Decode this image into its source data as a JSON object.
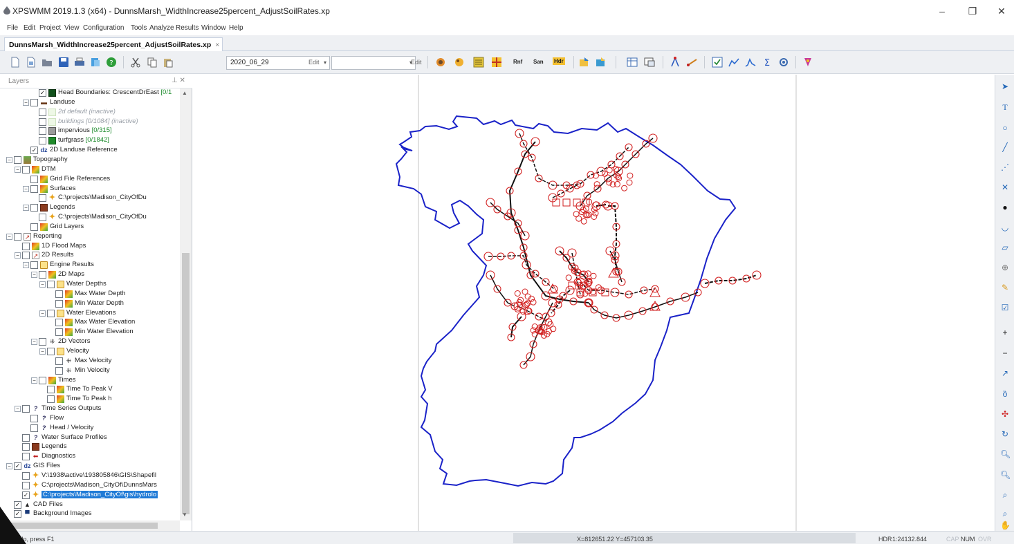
{
  "window": {
    "title": "XPSWMM 2019.1.3 (x64) - DunnsMarsh_WidthIncrease25percent_AdjustSoilRates.xp",
    "minimize": "–",
    "maximize": "❐",
    "close": "✕"
  },
  "menu": [
    "File",
    "Edit",
    "Project",
    "View",
    "Configuration",
    "Tools",
    "Analyze",
    "Results",
    "Window",
    "Help"
  ],
  "document_tab": {
    "label": "DunnsMarsh_WidthIncrease25percent_AdjustSoilRates.xp",
    "close": "×"
  },
  "toolbar": {
    "date_combo": "2020_06_29",
    "edit_label_1": "Edit",
    "second_combo": "",
    "edit_label_2": "Edit",
    "text_buttons": [
      "Rnf",
      "San",
      "Hdr"
    ]
  },
  "layers_panel": {
    "title": "Layers",
    "pin": "⊥ ✕",
    "tree": [
      {
        "level": 3,
        "expander": "",
        "checked": true,
        "icon": "dark-green-square",
        "label": "Head Boundaries: CrescentDrEast ",
        "count": "[0/1",
        "style": ""
      },
      {
        "level": 2,
        "expander": "−",
        "checked": false,
        "icon": "landuse-icon",
        "label": "Landuse",
        "count": "",
        "style": ""
      },
      {
        "level": 3,
        "expander": "",
        "checked": false,
        "icon": "faint-swatch",
        "label": "2d default (inactive)",
        "count": "",
        "style": "dim"
      },
      {
        "level": 3,
        "expander": "",
        "checked": false,
        "icon": "faint-swatch",
        "label": "buildings [0/1084] (inactive)",
        "count": "",
        "style": "dim"
      },
      {
        "level": 3,
        "expander": "",
        "checked": false,
        "icon": "gray-swatch",
        "label": "impervious ",
        "count": "[0/315]",
        "style": ""
      },
      {
        "level": 3,
        "expander": "",
        "checked": false,
        "icon": "green-swatch",
        "label": "turfgrass ",
        "count": "[0/1842]",
        "style": ""
      },
      {
        "level": 2,
        "expander": "",
        "checked": true,
        "icon": "link-icon",
        "label": "2D Landuse Reference",
        "count": "",
        "style": ""
      },
      {
        "level": 0,
        "expander": "−",
        "checked": false,
        "icon": "topography-icon",
        "label": "Topography",
        "count": "",
        "style": ""
      },
      {
        "level": 1,
        "expander": "−",
        "checked": false,
        "icon": "dtm-icon",
        "label": "DTM",
        "count": "",
        "style": ""
      },
      {
        "level": 2,
        "expander": "",
        "checked": false,
        "icon": "dtm-icon",
        "label": "Grid File References",
        "count": "",
        "style": ""
      },
      {
        "level": 2,
        "expander": "−",
        "checked": false,
        "icon": "dtm-icon",
        "label": "Surfaces",
        "count": "",
        "style": ""
      },
      {
        "level": 3,
        "expander": "",
        "checked": false,
        "icon": "plus-icon",
        "label": "C:\\projects\\Madison_CityOfDu",
        "count": "",
        "style": ""
      },
      {
        "level": 2,
        "expander": "−",
        "checked": false,
        "icon": "legend-icon",
        "label": "Legends",
        "count": "",
        "style": ""
      },
      {
        "level": 3,
        "expander": "",
        "checked": false,
        "icon": "plus-icon",
        "label": "C:\\projects\\Madison_CityOfDu",
        "count": "",
        "style": ""
      },
      {
        "level": 2,
        "expander": "",
        "checked": false,
        "icon": "dtm-icon",
        "label": "Grid Layers",
        "count": "",
        "style": ""
      },
      {
        "level": 0,
        "expander": "−",
        "checked": false,
        "icon": "reporting-icon",
        "label": "Reporting",
        "count": "",
        "style": ""
      },
      {
        "level": 1,
        "expander": "",
        "checked": false,
        "icon": "dtm-icon",
        "label": "1D Flood Maps",
        "count": "",
        "style": ""
      },
      {
        "level": 1,
        "expander": "−",
        "checked": false,
        "icon": "reporting-icon",
        "label": "2D Results",
        "count": "",
        "style": ""
      },
      {
        "level": 2,
        "expander": "−",
        "checked": false,
        "icon": "folder-icon",
        "label": "Engine Results",
        "count": "",
        "style": ""
      },
      {
        "level": 3,
        "expander": "−",
        "checked": false,
        "icon": "dtm-icon",
        "label": "2D Maps",
        "count": "",
        "style": ""
      },
      {
        "level": 4,
        "expander": "−",
        "checked": false,
        "icon": "folder-icon",
        "label": "Water Depths",
        "count": "",
        "style": ""
      },
      {
        "level": 5,
        "expander": "",
        "checked": false,
        "icon": "dtm-icon",
        "label": "Max Water Depth",
        "count": "",
        "style": ""
      },
      {
        "level": 5,
        "expander": "",
        "checked": false,
        "icon": "dtm-icon",
        "label": "Min Water Depth",
        "count": "",
        "style": ""
      },
      {
        "level": 4,
        "expander": "−",
        "checked": false,
        "icon": "folder-icon",
        "label": "Water Elevations",
        "count": "",
        "style": ""
      },
      {
        "level": 5,
        "expander": "",
        "checked": false,
        "icon": "dtm-icon",
        "label": "Max Water Elevation",
        "count": "",
        "style": ""
      },
      {
        "level": 5,
        "expander": "",
        "checked": false,
        "icon": "dtm-icon",
        "label": "Min Water Elevation",
        "count": "",
        "style": ""
      },
      {
        "level": 3,
        "expander": "−",
        "checked": false,
        "icon": "vector-icon",
        "label": "2D Vectors",
        "count": "",
        "style": ""
      },
      {
        "level": 4,
        "expander": "−",
        "checked": false,
        "icon": "folder-icon",
        "label": "Velocity",
        "count": "",
        "style": ""
      },
      {
        "level": 5,
        "expander": "",
        "checked": false,
        "icon": "vector-icon",
        "label": "Max Velocity",
        "count": "",
        "style": ""
      },
      {
        "level": 5,
        "expander": "",
        "checked": false,
        "icon": "vector-icon",
        "label": "Min Velocity",
        "count": "",
        "style": ""
      },
      {
        "level": 3,
        "expander": "−",
        "checked": false,
        "icon": "dtm-icon",
        "label": "Times",
        "count": "",
        "style": ""
      },
      {
        "level": 4,
        "expander": "",
        "checked": false,
        "icon": "dtm-icon",
        "label": "Time To Peak V",
        "count": "",
        "style": ""
      },
      {
        "level": 4,
        "expander": "",
        "checked": false,
        "icon": "dtm-icon",
        "label": "Time To Peak h",
        "count": "",
        "style": ""
      },
      {
        "level": 1,
        "expander": "−",
        "checked": false,
        "icon": "timeseries-icon",
        "label": "Time Series Outputs",
        "count": "",
        "style": ""
      },
      {
        "level": 2,
        "expander": "",
        "checked": false,
        "icon": "timeseries-icon",
        "label": "Flow",
        "count": "",
        "style": ""
      },
      {
        "level": 2,
        "expander": "",
        "checked": false,
        "icon": "timeseries-icon",
        "label": "Head / Velocity",
        "count": "",
        "style": ""
      },
      {
        "level": 1,
        "expander": "",
        "checked": false,
        "icon": "timeseries-icon",
        "label": "Water Surface Profiles",
        "count": "",
        "style": ""
      },
      {
        "level": 1,
        "expander": "",
        "checked": false,
        "icon": "legend-icon",
        "label": "Legends",
        "count": "",
        "style": ""
      },
      {
        "level": 1,
        "expander": "",
        "checked": false,
        "icon": "diagnostics-icon",
        "label": "Diagnostics",
        "count": "",
        "style": ""
      },
      {
        "level": 0,
        "expander": "−",
        "checked": true,
        "icon": "link-icon",
        "label": "GIS Files",
        "count": "",
        "style": ""
      },
      {
        "level": 1,
        "expander": "",
        "checked": false,
        "icon": "plus-icon",
        "label": "V:\\1938\\active\\193805846\\GIS\\Shapefil",
        "count": "",
        "style": ""
      },
      {
        "level": 1,
        "expander": "",
        "checked": false,
        "icon": "plus-icon",
        "label": "C:\\projects\\Madison_CityOf\\DunnsMars",
        "count": "",
        "style": ""
      },
      {
        "level": 1,
        "expander": "",
        "checked": true,
        "icon": "plus-icon",
        "label": "C:\\projects\\Madison_CityOf\\gis\\hydrolo",
        "count": "",
        "style": "sel"
      },
      {
        "level": 0,
        "expander": "",
        "checked": true,
        "icon": "cad-icon",
        "label": "CAD Files",
        "count": "",
        "style": ""
      },
      {
        "level": 0,
        "expander": "",
        "checked": true,
        "icon": "image-icon",
        "label": "Background Images",
        "count": "",
        "style": ""
      }
    ]
  },
  "statusbar": {
    "help": "For Help, press F1",
    "coords": "X=812651.22   Y=457103.35",
    "hdr": "HDR",
    "scale": "1:24132.844",
    "cap": "CAP",
    "num": "NUM",
    "ovr": "OVR"
  },
  "colors": {
    "boundary": "#1a22c8",
    "node": "#d22020",
    "link": "#111111",
    "selection": "#1f7ad6"
  }
}
